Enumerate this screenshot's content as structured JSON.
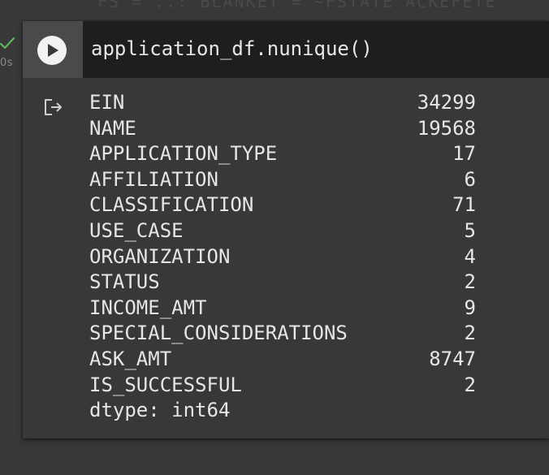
{
  "top_partial_text": "FS = ..: BLANKET = ~FSTATE ACKEFETE",
  "cell": {
    "execution_time": "0s",
    "code": "application_df.nunique()"
  },
  "output": {
    "rows": [
      {
        "name": "EIN",
        "value": "34299"
      },
      {
        "name": "NAME",
        "value": "19568"
      },
      {
        "name": "APPLICATION_TYPE",
        "value": "17"
      },
      {
        "name": "AFFILIATION",
        "value": "6"
      },
      {
        "name": "CLASSIFICATION",
        "value": "71"
      },
      {
        "name": "USE_CASE",
        "value": "5"
      },
      {
        "name": "ORGANIZATION",
        "value": "4"
      },
      {
        "name": "STATUS",
        "value": "2"
      },
      {
        "name": "INCOME_AMT",
        "value": "9"
      },
      {
        "name": "SPECIAL_CONSIDERATIONS",
        "value": "2"
      },
      {
        "name": "ASK_AMT",
        "value": "8747"
      },
      {
        "name": "IS_SUCCESSFUL",
        "value": "2"
      }
    ],
    "dtype": "dtype: int64"
  },
  "icons": {
    "run": "play-icon",
    "status": "check-icon",
    "output": "output-action-icon"
  },
  "colors": {
    "background": "#383838",
    "code_background": "#1e1e1e",
    "run_area": "#4a4a4a",
    "success_check": "#5cb85c",
    "text": "#e6e6e6"
  }
}
